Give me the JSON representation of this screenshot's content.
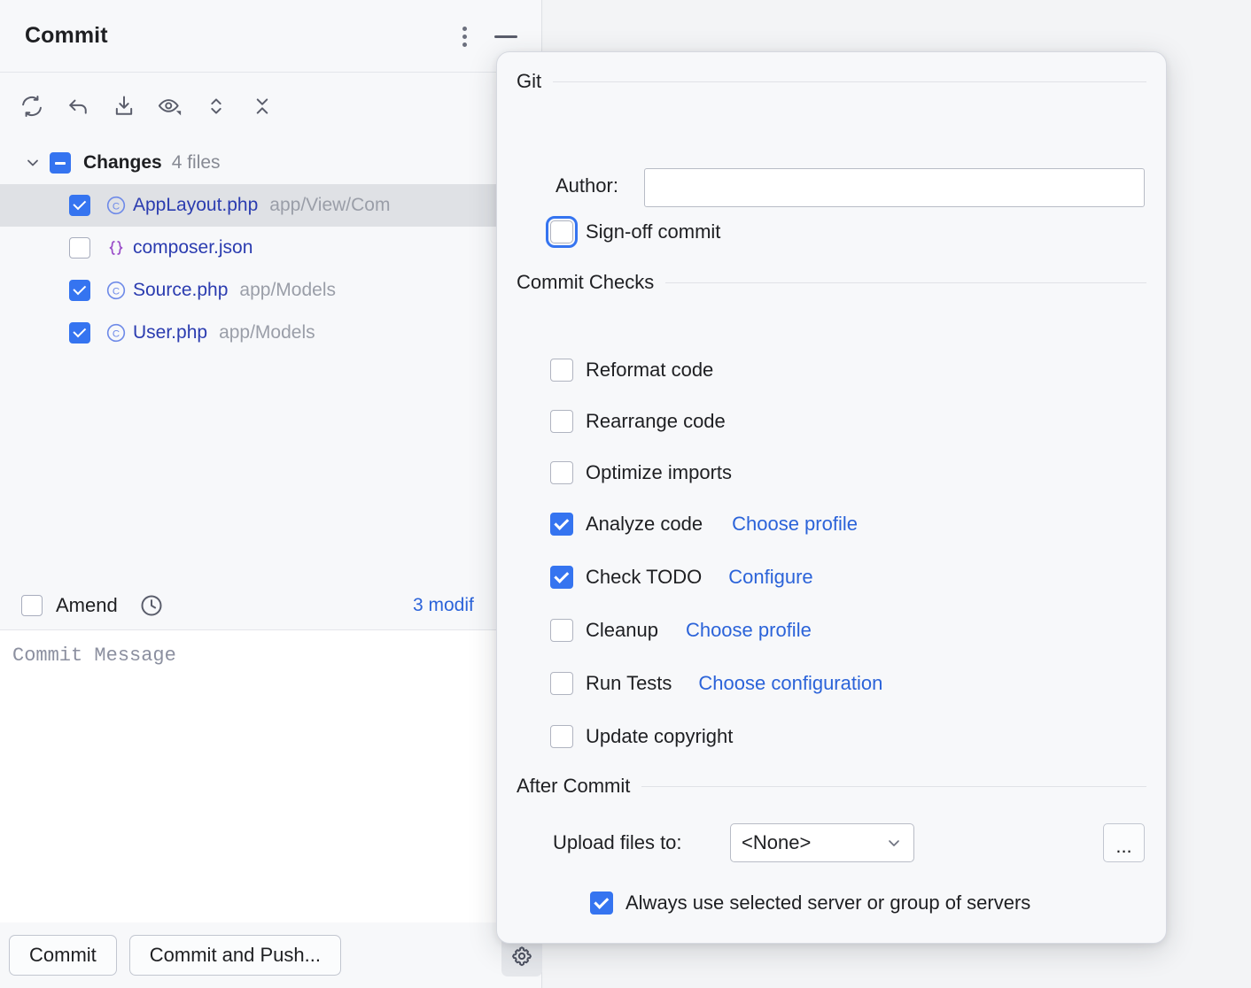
{
  "toolwindow": {
    "title": "Commit",
    "more_icon": "more-vertical-icon",
    "minimize_icon": "minimize-icon",
    "toolbar": [
      {
        "name": "refresh-changes-icon",
        "label": "Refresh"
      },
      {
        "name": "rollback-icon",
        "label": "Rollback"
      },
      {
        "name": "checkout-icon",
        "label": "Checkout"
      },
      {
        "name": "preview-diff-icon",
        "label": "Preview Diff"
      },
      {
        "name": "expand-collapse-icon",
        "label": "Expand/Collapse"
      },
      {
        "name": "collapse-all-icon",
        "label": "Collapse All"
      }
    ]
  },
  "changes_tree": {
    "group": {
      "label": "Changes",
      "count": "4 files",
      "checkbox_state": "indeterminate",
      "expanded": true
    },
    "files": [
      {
        "name": "AppLayout.php",
        "path": "app/View/Com",
        "checked": true,
        "selected": true,
        "icon": "php-class-icon"
      },
      {
        "name": "composer.json",
        "path": "",
        "checked": false,
        "selected": false,
        "icon": "json-file-icon"
      },
      {
        "name": "Source.php",
        "path": "app/Models",
        "checked": true,
        "selected": false,
        "icon": "php-class-icon"
      },
      {
        "name": "User.php",
        "path": "app/Models",
        "checked": true,
        "selected": false,
        "icon": "php-class-icon"
      }
    ]
  },
  "amend_bar": {
    "amend_label": "Amend",
    "amend_checked": false,
    "history_icon": "clock-history-icon",
    "modified_link": "3 modif"
  },
  "commit_message": {
    "placeholder": "Commit Message",
    "value": ""
  },
  "bottom_buttons": {
    "commit": "Commit",
    "commit_and_push": "Commit and Push...",
    "settings_icon": "gear-icon"
  },
  "popup": {
    "sections": {
      "git": {
        "title": "Git",
        "author_label": "Author:",
        "author_value": "",
        "author_placeholder": "",
        "signoff": {
          "label": "Sign-off commit",
          "checked": false,
          "focused": true
        }
      },
      "commit_checks": {
        "title": "Commit Checks",
        "items": [
          {
            "label": "Reformat code",
            "checked": false,
            "link": ""
          },
          {
            "label": "Rearrange code",
            "checked": false,
            "link": ""
          },
          {
            "label": "Optimize imports",
            "checked": false,
            "link": ""
          },
          {
            "label": "Analyze code",
            "checked": true,
            "link": "Choose profile"
          },
          {
            "label": "Check TODO",
            "checked": true,
            "link": "Configure"
          },
          {
            "label": "Cleanup",
            "checked": false,
            "link": "Choose profile"
          },
          {
            "label": "Run Tests",
            "checked": false,
            "link": "Choose configuration"
          },
          {
            "label": "Update copyright",
            "checked": false,
            "link": ""
          }
        ]
      },
      "after_commit": {
        "title": "After Commit",
        "upload_label": "Upload files to:",
        "upload_value": "<None>",
        "browse_label": "...",
        "always_use": {
          "label": "Always use selected server or group of servers",
          "checked": true
        }
      }
    }
  },
  "colors": {
    "accent_blue": "#3574f0",
    "link_blue": "#2b63d9",
    "file_name_blue": "#2b3cb0",
    "panel_bg": "#f7f8fa",
    "selected_row": "#dfe1e5",
    "muted_text": "#9a9ea8"
  }
}
